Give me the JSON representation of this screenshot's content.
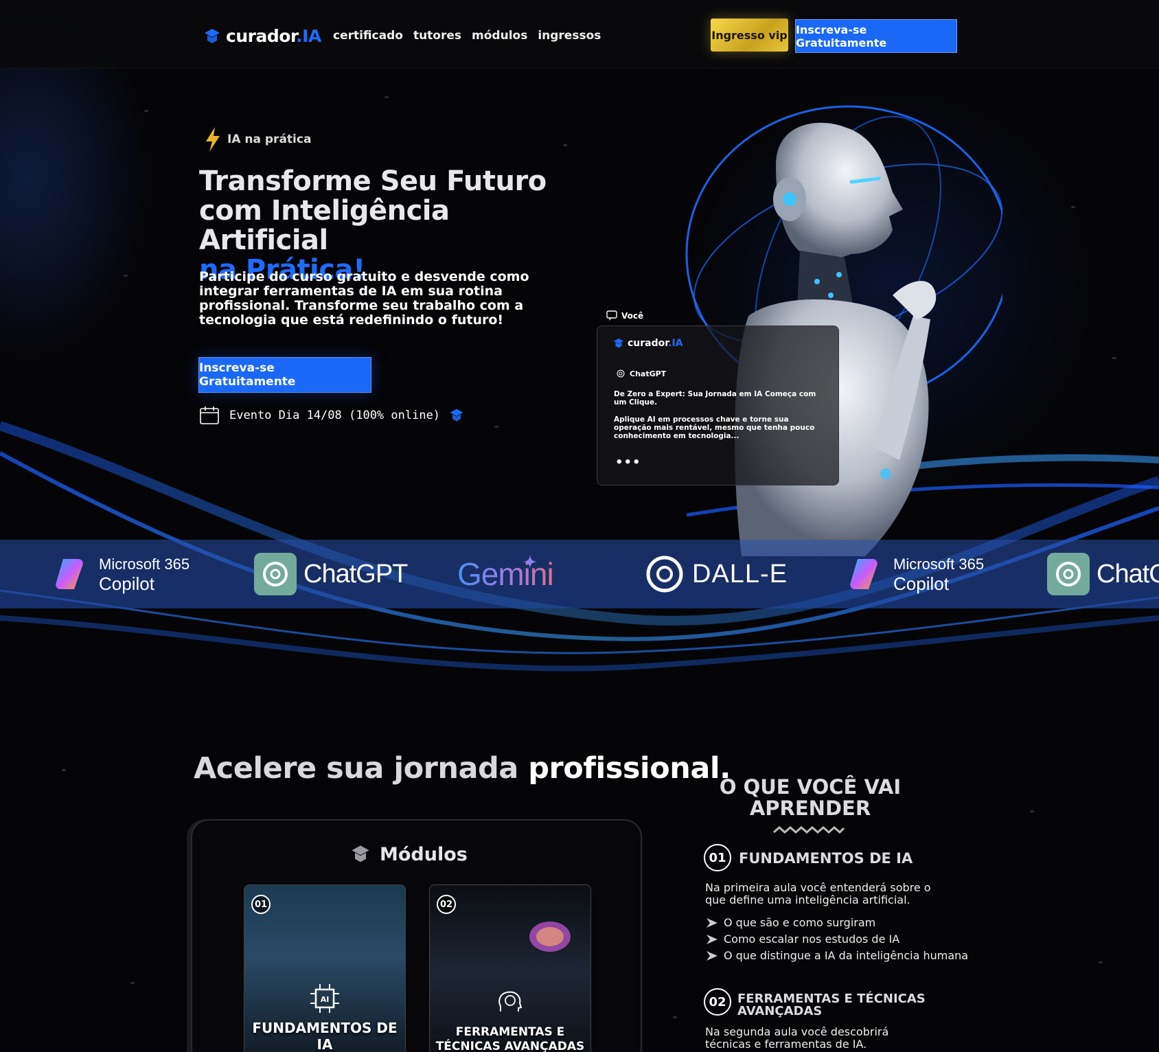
{
  "nav": {
    "logo_main": "curador",
    "logo_suffix": ".IA",
    "links": [
      "certificado",
      "tutores",
      "módulos",
      "ingressos"
    ],
    "vip_label": "Ingresso vip",
    "cta_label": "Inscreva-se Gratuitamente"
  },
  "hero": {
    "tag": "IA na prática",
    "title_line1": "Transforme Seu Futuro",
    "title_line2": "com Inteligência Artificial",
    "title_accent": "na Prática!",
    "subtitle": "Participe do curso gratuito e desvende como integrar ferramentas de IA em sua rotina profissional. Transforme seu trabalho com a tecnologia que está redefinindo o futuro!",
    "cta_label": "Inscreva-se Gratuitamente",
    "event": "Evento Dia 14/08 (100% online)"
  },
  "chat": {
    "user_label": "Você",
    "logo_main": "curador",
    "logo_suffix": ".IA",
    "bot_name": "ChatGPT",
    "line1": "De Zero a Expert: Sua Jornada em IA Começa com um Clique.",
    "line2": "Aplique AI em processos chave e torne sua operação mais rentável, mesmo que tenha pouco conhecimento em tecnologia...",
    "dots": "•••"
  },
  "tools": {
    "copilot_line1": "Microsoft 365",
    "copilot_line2": "Copilot",
    "chatgpt": "ChatGPT",
    "chatgpt_partial": "ChatG",
    "gemini": "Gemini",
    "dalle": "DALL-E"
  },
  "section": {
    "title_light": "Acelere sua jornada",
    "title_strong": "profissional."
  },
  "modules": {
    "heading": "Módulos",
    "items": [
      {
        "num": "01",
        "title": "FUNDAMENTOS DE IA"
      },
      {
        "num": "02",
        "title": "FERRAMENTAS E TÉCNICAS AVANÇADAS"
      }
    ]
  },
  "learn": {
    "title": "O QUE VOCÊ VAI APRENDER",
    "lessons": [
      {
        "num": "01",
        "title": "FUNDAMENTOS DE IA",
        "desc": "Na primeira aula você entenderá sobre o que define uma inteligência artificial.",
        "bullets": [
          "O que são e como surgiram",
          "Como escalar nos estudos de IA",
          "O que distingue a IA da inteligência humana"
        ]
      },
      {
        "num": "02",
        "title": "FERRAMENTAS E TÉCNICAS AVANÇADAS",
        "desc": "Na segunda aula você descobrirá técnicas e ferramentas de IA."
      }
    ]
  },
  "colors": {
    "accent": "#1e6bff",
    "vip_gold": "#e8c63a",
    "background": "#050507"
  }
}
